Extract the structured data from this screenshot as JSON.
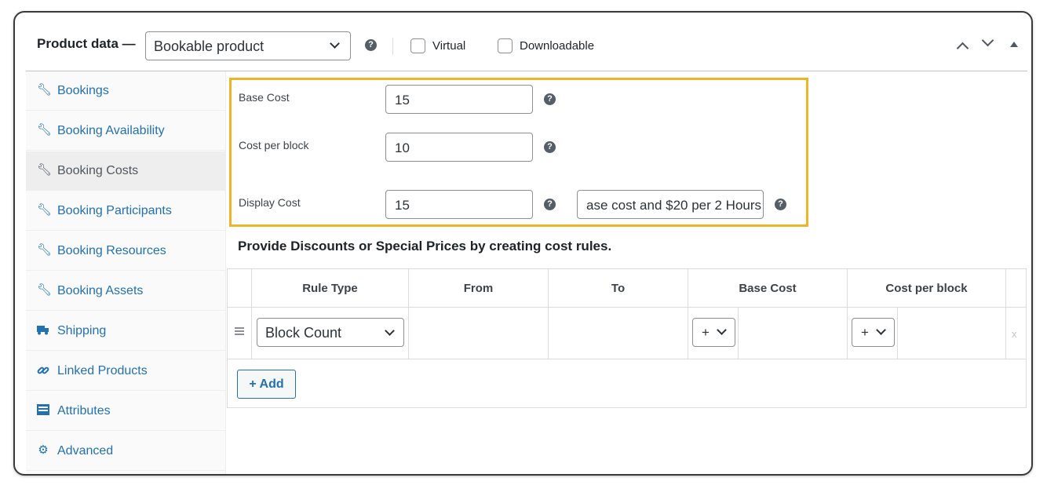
{
  "header": {
    "title": "Product data —",
    "product_type": "Bookable product",
    "virtual_label": "Virtual",
    "downloadable_label": "Downloadable",
    "help_glyph": "?"
  },
  "sidebar": {
    "items": [
      {
        "label": "Bookings",
        "icon": "wrench-icon"
      },
      {
        "label": "Booking Availability",
        "icon": "wrench-icon"
      },
      {
        "label": "Booking Costs",
        "icon": "wrench-icon",
        "active": true
      },
      {
        "label": "Booking Participants",
        "icon": "wrench-icon"
      },
      {
        "label": "Booking Resources",
        "icon": "wrench-icon"
      },
      {
        "label": "Booking Assets",
        "icon": "wrench-icon"
      },
      {
        "label": "Shipping",
        "icon": "truck-icon"
      },
      {
        "label": "Linked Products",
        "icon": "link-icon"
      },
      {
        "label": "Attributes",
        "icon": "list-icon"
      },
      {
        "label": "Advanced",
        "icon": "gear-icon"
      }
    ]
  },
  "costs": {
    "base_cost_label": "Base Cost",
    "base_cost_value": "15",
    "cost_per_block_label": "Cost per block",
    "cost_per_block_value": "10",
    "display_cost_label": "Display Cost",
    "display_cost_value": "15",
    "display_cost_text": "ase cost and $20 per 2 Hours"
  },
  "rules": {
    "note": "Provide Discounts or Special Prices by creating cost rules.",
    "columns": [
      "Rule Type",
      "From",
      "To",
      "Base Cost",
      "Cost per block"
    ],
    "row": {
      "rule_type": "Block Count",
      "base_modifier": "+",
      "block_modifier": "+",
      "remove": "x"
    },
    "add_label": "+ Add"
  },
  "colors": {
    "accent": "#2271b1",
    "highlight": "#f0b429"
  }
}
